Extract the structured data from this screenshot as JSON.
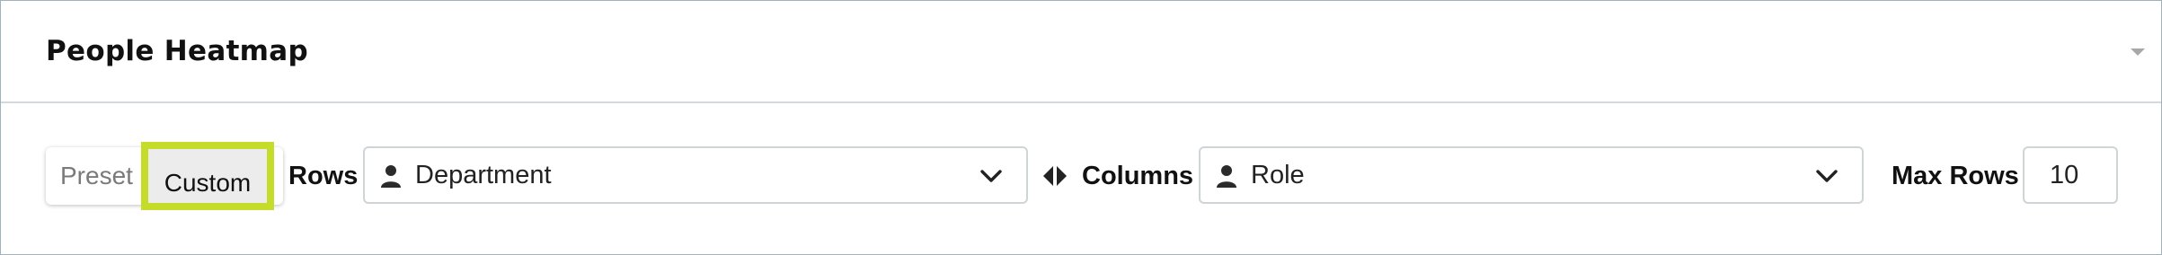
{
  "panel": {
    "title": "People Heatmap"
  },
  "mode_toggle": {
    "preset_label": "Preset",
    "custom_label": "Custom",
    "selected": "Custom",
    "highlight_color": "#c5dd2a"
  },
  "rows": {
    "label": "Rows",
    "value": "Department",
    "icon": "person-icon"
  },
  "swap": {
    "icon": "swap-arrows-icon"
  },
  "columns": {
    "label": "Columns",
    "value": "Role",
    "icon": "person-icon"
  },
  "max_rows": {
    "label": "Max Rows",
    "value": "10"
  }
}
